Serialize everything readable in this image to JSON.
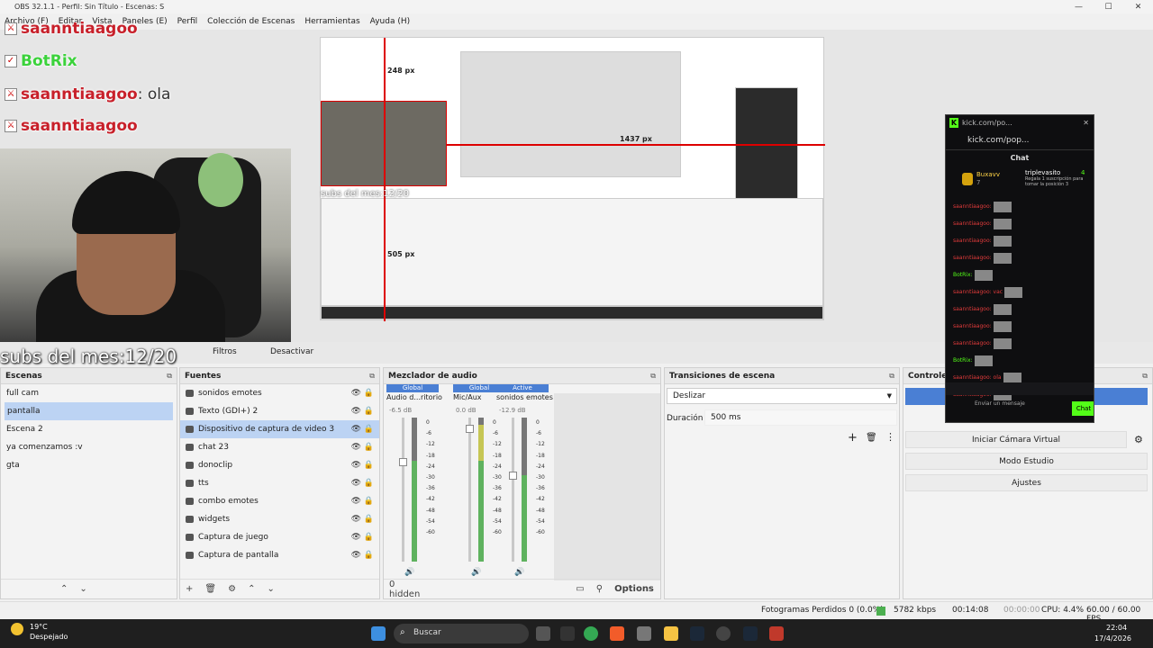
{
  "window": {
    "title": "OBS 32.1.1 - Perfil: Sin Título - Escenas: S",
    "minimize": "—",
    "maximize": "☐",
    "close": "✕"
  },
  "menu": [
    "Archivo (F)",
    "Editar",
    "Vista",
    "Paneles (E)",
    "Perfil",
    "Colección de Escenas",
    "Herramientas",
    "Ayuda (H)"
  ],
  "overlay": {
    "chat": [
      {
        "user": "saanntiaagoo",
        "msg": ""
      },
      {
        "user": "BotRix",
        "msg": ""
      },
      {
        "user": "saanntiaagoo",
        "msg": ": ola"
      },
      {
        "user": "saanntiaagoo",
        "msg": ""
      }
    ],
    "subs": "subs del mes:12/20",
    "inner_subs": "subs del mes:12/20",
    "px_labels": [
      "248 px",
      "1437 px",
      "505 px"
    ]
  },
  "context_bar": {
    "filters": "Filtros",
    "disable": "Desactivar"
  },
  "scenes": {
    "title": "Escenas",
    "items": [
      "full cam",
      "pantalla",
      "Escena 2",
      "ya comenzamos :v",
      "gta"
    ],
    "selected": 1
  },
  "sources": {
    "title": "Fuentes",
    "items": [
      {
        "name": "sonidos emotes",
        "locked": false
      },
      {
        "name": "Texto (GDI+) 2",
        "locked": false
      },
      {
        "name": "Dispositivo de captura de video 3",
        "locked": false
      },
      {
        "name": "chat 23",
        "locked": false
      },
      {
        "name": "donoclip",
        "locked": false
      },
      {
        "name": "tts",
        "locked": true
      },
      {
        "name": "combo emotes",
        "locked": true
      },
      {
        "name": "widgets",
        "locked": false
      },
      {
        "name": "Captura de juego",
        "locked": true
      },
      {
        "name": "Captura de pantalla",
        "locked": false
      }
    ],
    "selected": 2
  },
  "mixer": {
    "title": "Mezclador de audio",
    "channels": [
      {
        "tag": "Global",
        "name": "Audio d...ritorio",
        "db": "-6.5 dB",
        "level": 0.7
      },
      {
        "tag": "Global",
        "name": "Mic/Aux",
        "db": "0.0 dB",
        "level": 0.95
      },
      {
        "tag": "Active",
        "name": "sonidos emotes",
        "db": "-12.9 dB",
        "level": 0.6
      }
    ],
    "ticks": [
      "0",
      "-6",
      "-12",
      "-18",
      "-24",
      "-30",
      "-36",
      "-42",
      "-48",
      "-54",
      "-60"
    ],
    "hidden": "0 hidden",
    "options": "Options"
  },
  "transitions": {
    "title": "Transiciones de escena",
    "selected": "Deslizar",
    "duration_label": "Duración",
    "duration": "500 ms"
  },
  "controls": {
    "title": "Controles",
    "buttons": [
      "Iniciar Cámara Virtual",
      "Modo Estudio",
      "Ajustes"
    ]
  },
  "kick": {
    "titlebar": "kick.com/po...",
    "url": "kick.com/pop...",
    "chat": "Chat",
    "gifter": "Buxavv",
    "gifter_count": "7",
    "top_user": "triplevasito",
    "top_count": "4",
    "gift_text": "Regala 1 suscripción para tomar la posición 3",
    "lines": [
      "saanntiaagoo:",
      "saanntiaagoo:",
      "saanntiaagoo:",
      "saanntiaagoo:",
      "BotRix:",
      "saanntiaagoo: vac",
      "saanntiaagoo:",
      "saanntiaagoo:",
      "saanntiaagoo:",
      "BotRix:",
      "saanntiaagoo: ola",
      "saanntiaagoo:"
    ],
    "input": "Enviar un mensaje",
    "send": "Chat"
  },
  "status": {
    "dropped": "Fotogramas Perdidos 0 (0.0%)",
    "kbps": "5782 kbps",
    "rec_time": "00:14:08",
    "stream_time": "00:00:00",
    "cpu": "CPU: 4.4%",
    "fps": "60.00 / 60.00 FPS"
  },
  "taskbar": {
    "weather_temp": "19°C",
    "weather_desc": "Despejado",
    "search": "Buscar",
    "time": "22:04",
    "date": "17/4/2026"
  },
  "colors": {
    "accent": "#4a7fd4",
    "kick_green": "#53fc18",
    "chat_red": "#c8202a"
  }
}
